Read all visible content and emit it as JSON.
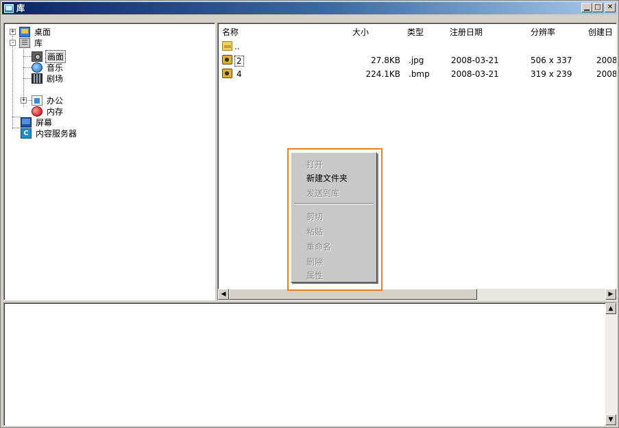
{
  "window": {
    "title": "库"
  },
  "tree": {
    "items": [
      {
        "label": "桌面",
        "icon": "desktop-icon"
      },
      {
        "label": "库",
        "icon": "library-icon"
      },
      {
        "label": "画面",
        "icon": "photo-icon"
      },
      {
        "label": "音乐",
        "icon": "music-icon"
      },
      {
        "label": "剧场",
        "icon": "film-icon"
      },
      {
        "label": "办公",
        "icon": "office-icon"
      },
      {
        "label": "内存",
        "icon": "memory-icon"
      },
      {
        "label": "屏幕",
        "icon": "screen-icon"
      },
      {
        "label": "内容服务器",
        "icon": "content-server-icon"
      }
    ],
    "expanders": {
      "desktop": "+",
      "library": "-",
      "office": "+"
    },
    "server_icon_letter": "C"
  },
  "list": {
    "columns": [
      "名称",
      "大小",
      "类型",
      "注册日期",
      "分辨率",
      "创建日"
    ],
    "rows": [
      {
        "name": "..",
        "size": "",
        "type": "",
        "date": "",
        "resolution": "",
        "created": ""
      },
      {
        "name": "2",
        "size": "27.8KB",
        "type": ".jpg",
        "date": "2008-03-21",
        "resolution": "506 x 337",
        "created": "2008"
      },
      {
        "name": "4",
        "size": "224.1KB",
        "type": ".bmp",
        "date": "2008-03-21",
        "resolution": "319 x 239",
        "created": "2008"
      }
    ]
  },
  "context_menu": {
    "items": [
      {
        "label": "打开",
        "enabled": false
      },
      {
        "label": "新建文件夹",
        "enabled": true
      },
      {
        "label": "发送到库",
        "enabled": false
      },
      {
        "label": "剪切",
        "enabled": false
      },
      {
        "label": "粘贴",
        "enabled": false
      },
      {
        "label": "重命名",
        "enabled": false
      },
      {
        "label": "删除",
        "enabled": false
      },
      {
        "label": "属性",
        "enabled": false
      }
    ],
    "highlight_color": "#f08020"
  },
  "colors": {
    "titlebar_start": "#0a246a",
    "titlebar_end": "#a6caf0",
    "face": "#d4d0c8"
  }
}
